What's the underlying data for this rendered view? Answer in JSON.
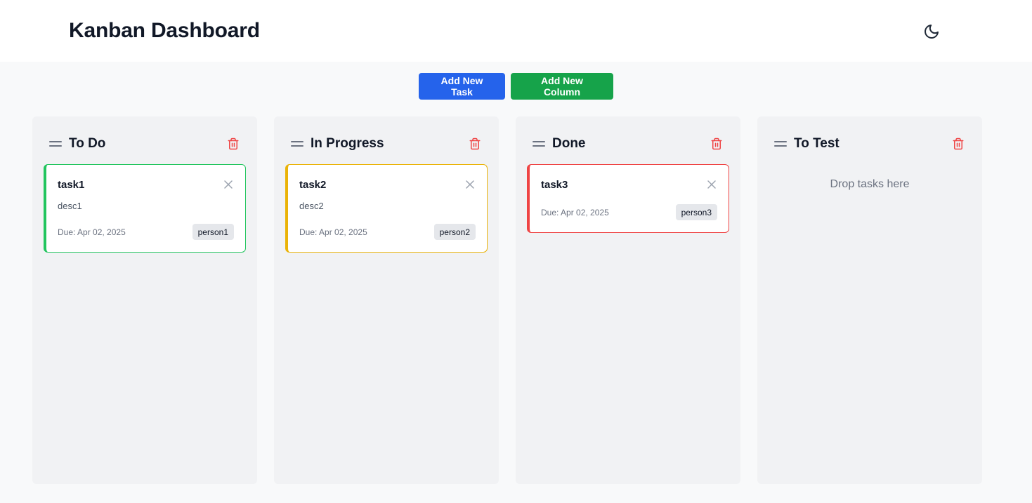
{
  "app": {
    "title": "Kanban Dashboard"
  },
  "header": {
    "theme_icon": "moon-icon"
  },
  "toolbar": {
    "add_task_label": "Add New Task",
    "add_column_label": "Add New Column"
  },
  "colors": {
    "primary_blue": "#2563eb",
    "primary_green": "#16a34a",
    "danger_red": "#ef4444",
    "todo_accent": "#22c55e",
    "progress_accent": "#eab308",
    "done_accent": "#ef4444"
  },
  "columns": [
    {
      "title": "To Do",
      "tasks": [
        {
          "title": "task1",
          "description": "desc1",
          "due": "Due: Apr 02, 2025",
          "assignee": "person1",
          "accent": "#22c55e"
        }
      ]
    },
    {
      "title": "In Progress",
      "tasks": [
        {
          "title": "task2",
          "description": "desc2",
          "due": "Due: Apr 02, 2025",
          "assignee": "person2",
          "accent": "#eab308"
        }
      ]
    },
    {
      "title": "Done",
      "tasks": [
        {
          "title": "task3",
          "description": "",
          "due": "Due: Apr 02, 2025",
          "assignee": "person3",
          "accent": "#ef4444"
        }
      ]
    },
    {
      "title": "To Test",
      "tasks": [],
      "empty_hint": "Drop tasks here"
    }
  ]
}
